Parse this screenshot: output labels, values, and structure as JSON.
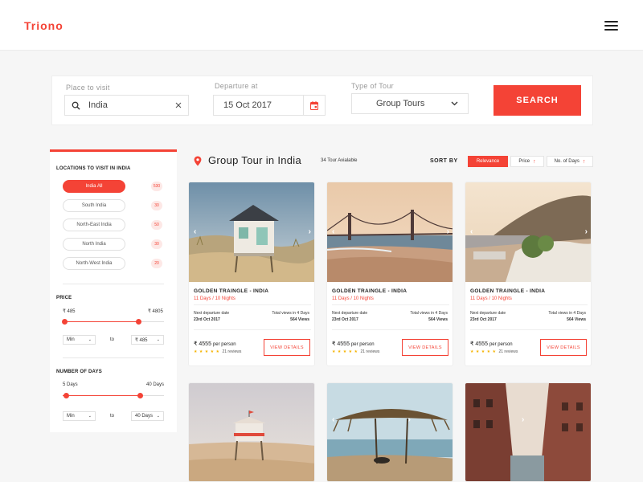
{
  "app": {
    "logo": "Triono"
  },
  "search": {
    "place_label": "Place to visit",
    "place_value": "India",
    "departure_label": "Departure at",
    "departure_value": "15 Oct 2017",
    "tour_type_label": "Type of Tour",
    "tour_type_value": "Group Tours",
    "button": "SEARCH"
  },
  "sidebar": {
    "locations_title": "LOCATIONS TO VISIT IN INDIA",
    "locations": [
      {
        "label": "India All",
        "count": "530",
        "active": true
      },
      {
        "label": "South India",
        "count": "30",
        "active": false
      },
      {
        "label": "North-East India",
        "count": "50",
        "active": false
      },
      {
        "label": "North India",
        "count": "30",
        "active": false
      },
      {
        "label": "North-West India",
        "count": "20",
        "active": false
      }
    ],
    "price": {
      "title": "PRICE",
      "min_label": "₹ 485",
      "max_label": "₹ 4805",
      "min_select": "Min",
      "to": "to",
      "max_select": "₹ 485"
    },
    "days": {
      "title": "NUMBER OF DAYS",
      "min_label": "5 Days",
      "max_label": "40 Days",
      "min_select": "Min",
      "to": "to",
      "max_select": "40 Days"
    }
  },
  "results": {
    "title": "Group Tour in India",
    "count": "34 Tour Avialable",
    "sort_label": "SORT BY",
    "sort_options": [
      "Relevance",
      "Price",
      "No. of Days"
    ]
  },
  "cards": [
    {
      "title": "GOLDEN TRAINGLE - INDIA",
      "duration": "11 Days / 10 Nights",
      "departure_label": "Next departure date",
      "departure_value": "23rd Oct 2017",
      "views_label": "Total views in 4 Days",
      "views_value": "564 Views",
      "price": "₹ 4555",
      "per": "per person",
      "stars": "★ ★ ★ ★ ★",
      "reviews": "21 reviews",
      "button": "VIEW DETAILS"
    },
    {
      "title": "GOLDEN TRAINGLE - INDIA",
      "duration": "11 Days / 10 Nights",
      "departure_label": "Next departure date",
      "departure_value": "23rd Oct 2017",
      "views_label": "Total views in 4 Days",
      "views_value": "564 Views",
      "price": "₹ 4555",
      "per": "per person",
      "stars": "★ ★ ★ ★ ★",
      "reviews": "21 reviews",
      "button": "VIEW DETAILS"
    },
    {
      "title": "GOLDEN TRAINGLE - INDIA",
      "duration": "11 Days / 10 Nights",
      "departure_label": "Next departure date",
      "departure_value": "23rd Oct 2017",
      "views_label": "Total views in 4 Days",
      "views_value": "564 Views",
      "price": "₹ 4555",
      "per": "per person",
      "stars": "★ ★ ★ ★ ★",
      "reviews": "21 reviews",
      "button": "VIEW DETAILS"
    }
  ],
  "icons": {
    "prev": "‹",
    "next": "›",
    "sort_arrow": "↑"
  },
  "colors": {
    "accent": "#f44336",
    "star": "#f5b301"
  }
}
